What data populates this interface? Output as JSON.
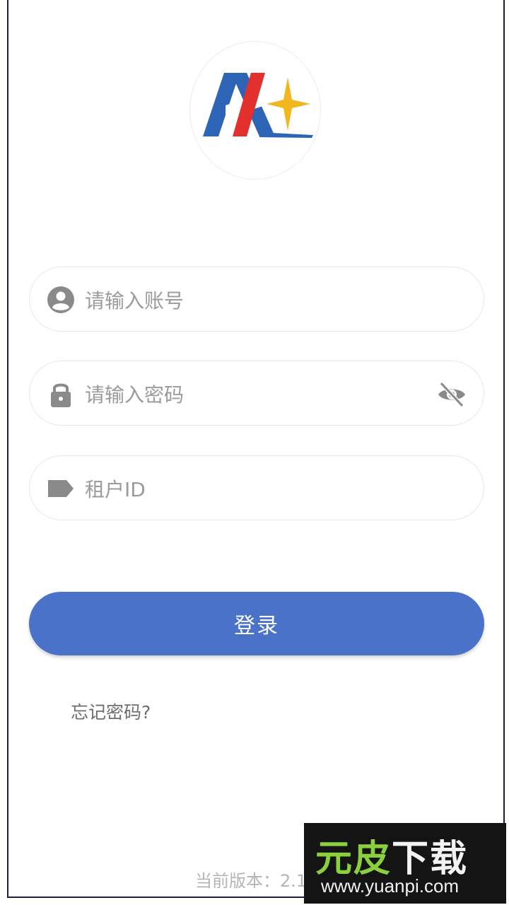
{
  "logo": {
    "icon": "brand-logo-star-icon",
    "colors": {
      "blue": "#2e64b5",
      "red": "#e2312c",
      "star": "#f2b71f"
    }
  },
  "form": {
    "account": {
      "placeholder": "请输入账号",
      "value": "",
      "icon": "user-icon"
    },
    "password": {
      "placeholder": "请输入密码",
      "value": "",
      "icon": "lock-icon",
      "toggle_icon": "eye-off-icon"
    },
    "tenant": {
      "placeholder": "租户ID",
      "value": "",
      "icon": "tag-icon"
    }
  },
  "login_button": {
    "label": "登录",
    "color": "#4a72c9"
  },
  "forgot_password": {
    "label": "忘记密码?"
  },
  "version": {
    "text": "当前版本：2.16"
  },
  "watermark": {
    "title_part1": "元皮",
    "title_part2": "下载",
    "url": "www.yuanpi.com"
  }
}
